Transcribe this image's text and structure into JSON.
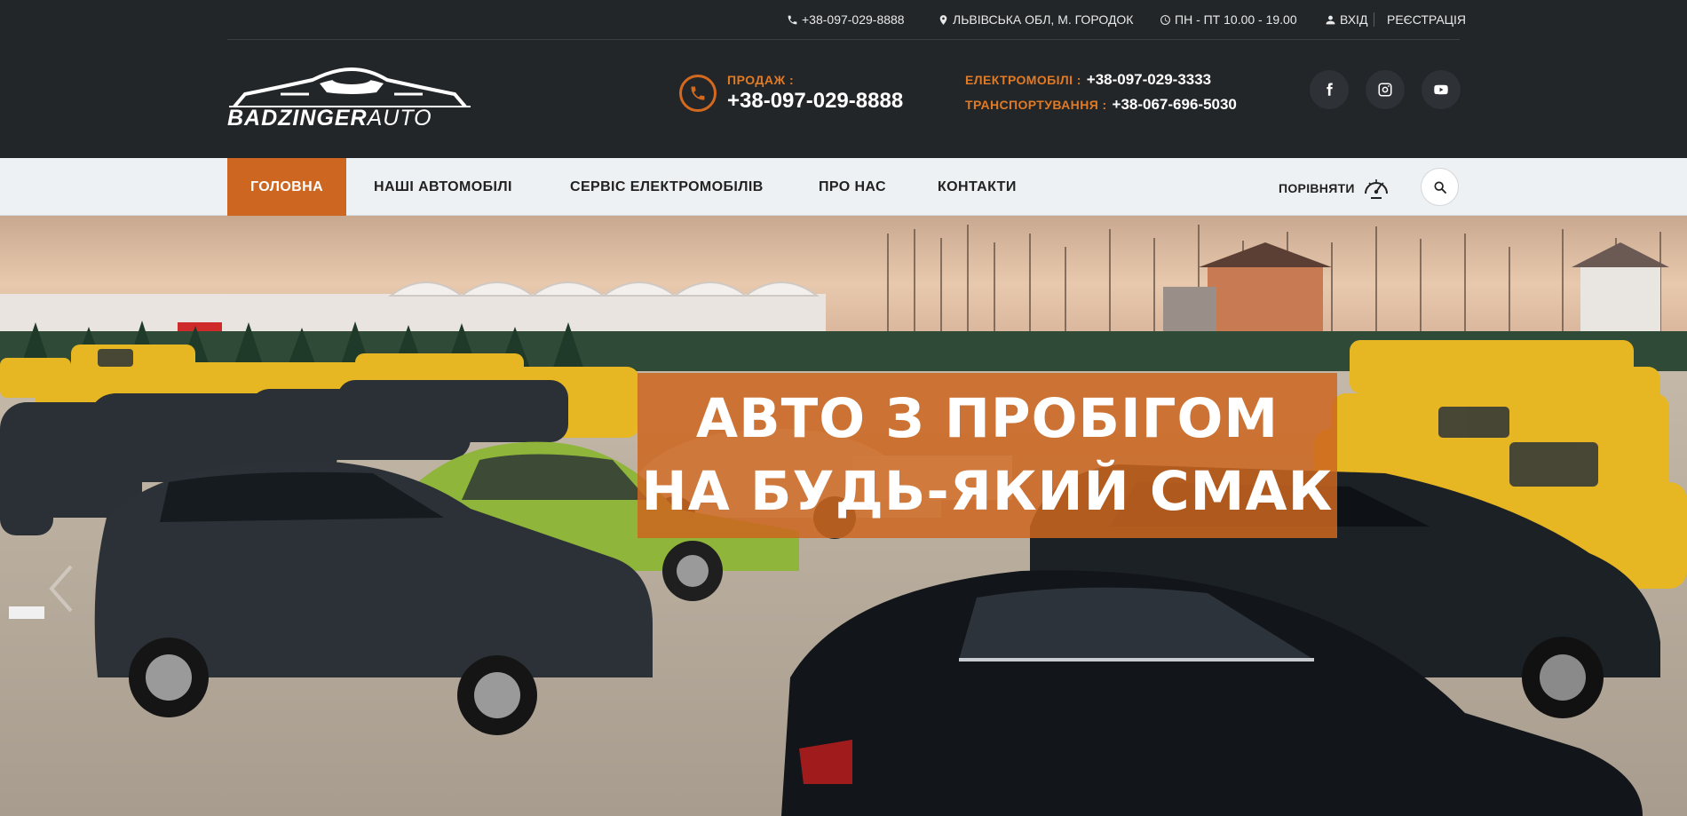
{
  "topline": {
    "phone": "+38-097-029-8888",
    "address": "ЛЬВІВСЬКА ОБЛ, М. ГОРОДОК",
    "hours": "ПН - ПТ 10.00 - 19.00",
    "login": "ВХІД",
    "register": "РЕЄСТРАЦІЯ"
  },
  "logo": {
    "bold": "BADZINGER",
    "thin": "AUTO"
  },
  "sale": {
    "label": "ПРОДАЖ :",
    "phone": "+38-097-029-8888"
  },
  "contacts": [
    {
      "label": "ЕЛЕКТРОМОБІЛІ :",
      "phone": "+38-097-029-3333"
    },
    {
      "label": "ТРАНСПОРТУВАННЯ :",
      "phone": "+38-067-696-5030"
    }
  ],
  "social": [
    "facebook-icon",
    "instagram-icon",
    "youtube-icon"
  ],
  "nav": {
    "items": [
      "ГОЛОВНА",
      "НАШІ АВТОМОБІЛІ",
      "СЕРВІС ЕЛЕКТРОМОБІЛІВ",
      "ПРО НАС",
      "КОНТАКТИ"
    ],
    "compare": "ПОРІВНЯТИ"
  },
  "hero": {
    "line1": "АВТО З ПРОБІГОМ",
    "line2": "НА БУДЬ-ЯКИЙ СМАК"
  },
  "colors": {
    "accent": "#cc6620",
    "dark": "#232629",
    "nav_bg": "#eef1f3"
  }
}
